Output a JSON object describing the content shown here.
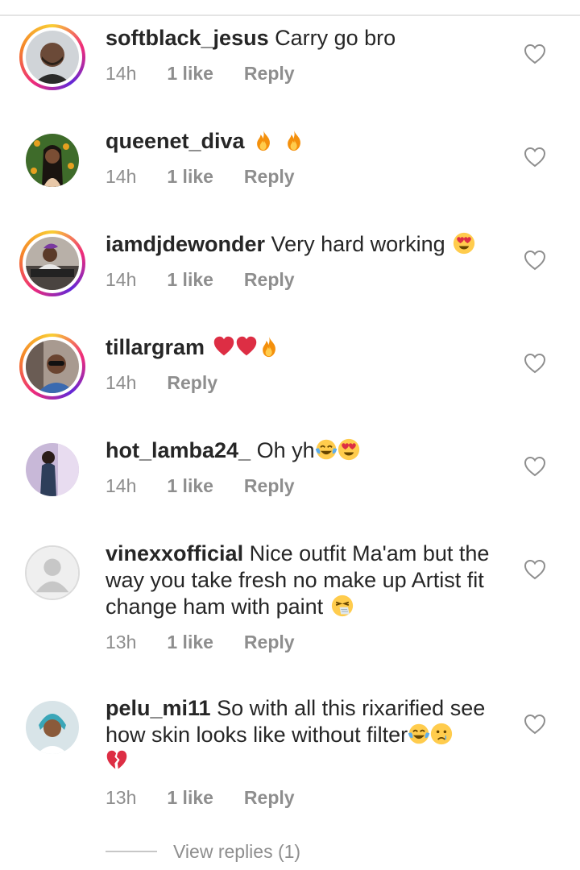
{
  "comments": [
    {
      "username": "softblack_jesus",
      "text": "Carry go bro",
      "time": "14h",
      "likes": "1 like",
      "reply": "Reply"
    },
    {
      "username": "queenet_diva",
      "text": "",
      "time": "14h",
      "likes": "1 like",
      "reply": "Reply"
    },
    {
      "username": "iamdjdewonder",
      "text": "Very hard working",
      "time": "14h",
      "likes": "1 like",
      "reply": "Reply"
    },
    {
      "username": "tillargram",
      "text": "",
      "time": "14h",
      "reply": "Reply"
    },
    {
      "username": "hot_lamba24_",
      "text": "Oh yh",
      "time": "14h",
      "likes": "1 like",
      "reply": "Reply"
    },
    {
      "username": "vinexxofficial",
      "text": "Nice outfit Ma'am but the way you take fresh no make up Artist fit change ham with paint",
      "time": "13h",
      "likes": "1 like",
      "reply": "Reply"
    },
    {
      "username": "pelu_mi11",
      "text": "So with all this rixarified see how skin looks like without filter",
      "time": "13h",
      "likes": "1 like",
      "reply": "Reply"
    }
  ],
  "view_replies": "View replies (1)",
  "colors": {
    "text": "#262626",
    "secondary": "#8e8e8e",
    "divider": "#e4e4e4"
  },
  "icons": [
    "heart-outline-icon",
    "fire-emoji",
    "heart-eyes-emoji",
    "red-heart-emoji",
    "tears-of-joy-emoji",
    "sneezing-face-emoji",
    "crying-face-emoji",
    "broken-heart-emoji"
  ]
}
